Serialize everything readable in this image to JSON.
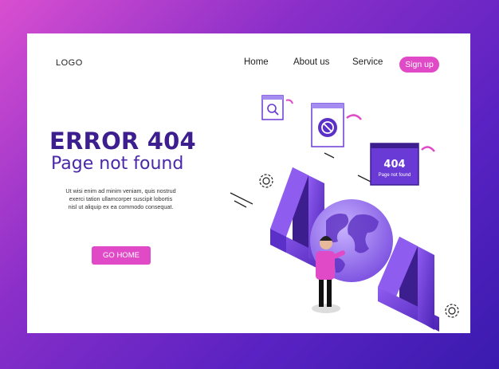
{
  "nav": {
    "logo": "LOGO",
    "home": "Home",
    "about": "About us",
    "service": "Service",
    "signup": "Sign up"
  },
  "hero": {
    "title": "ERROR 404",
    "subtitle": "Page not found",
    "body_lines": [
      "Ut wisi enim ad minim veniam, quis nostrud",
      "exerci tation ullamcorper suscipit lobortis",
      "nisl ut aliquip ex ea commodo consequat."
    ],
    "button": "GO HOME"
  },
  "illustration": {
    "card_text_number": "404",
    "card_text_label": "Page not found",
    "colors": {
      "purple_dark": "#3d1e8f",
      "purple": "#6a3ad6",
      "purple_light": "#a48cf0",
      "pink": "#e04ac7"
    }
  }
}
